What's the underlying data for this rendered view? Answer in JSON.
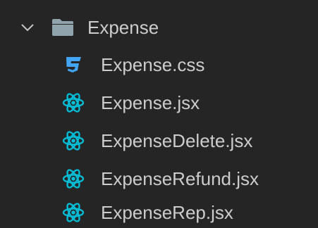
{
  "folder": {
    "name": "Expense",
    "expanded": true,
    "icon": "folder-open-icon",
    "chevron_icon": "chevron-down-icon"
  },
  "files": [
    {
      "name": "Expense.css",
      "icon": "css3-icon",
      "icon_color": "#42a5f5"
    },
    {
      "name": "Expense.jsx",
      "icon": "react-icon",
      "icon_color": "#00bcd4"
    },
    {
      "name": "ExpenseDelete.jsx",
      "icon": "react-icon",
      "icon_color": "#00bcd4"
    },
    {
      "name": "ExpenseRefund.jsx",
      "icon": "react-icon",
      "icon_color": "#00bcd4"
    },
    {
      "name": "ExpenseRep.jsx",
      "icon": "react-icon",
      "icon_color": "#00bcd4"
    }
  ],
  "colors": {
    "background": "#252526",
    "text": "#cccccc",
    "folder_icon": "#90a4ae"
  }
}
